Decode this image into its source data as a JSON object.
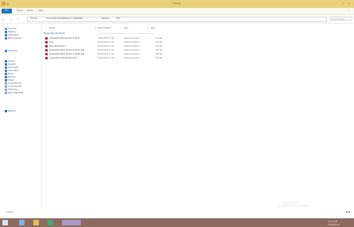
{
  "window": {
    "title": "Pictures",
    "controls": [
      "–",
      "□",
      "×"
    ]
  },
  "ribbon": {
    "file_tab": "File",
    "tabs": [
      "Home",
      "Share",
      "View"
    ],
    "help": "?"
  },
  "address": {
    "back": "←",
    "forward": "→",
    "up": "↑",
    "path": [
      "This PC",
      "Documents and Settings (C:) DataFiles",
      "Desktop",
      "Pict"
    ],
    "search_placeholder": "Search Pictures"
  },
  "navigation": {
    "favorites": [
      "Favorites",
      "Desktop",
      "Downloads",
      "Recent places"
    ],
    "cloud": [
      "OneDrive"
    ],
    "this_pc": [
      "This PC",
      "Desktop",
      "Documents",
      "Downloads",
      "Music",
      "Pictures",
      "Videos",
      "Local Disk (C:)",
      "Local Disk (D:)",
      "DVD Drive",
      "Removable Disk"
    ],
    "network": [
      "Network"
    ]
  },
  "columns": {
    "name": "Name",
    "date": "Date modified",
    "type": "Type",
    "size": "Size"
  },
  "group": {
    "label": "Earlier this month (6)"
  },
  "files": [
    {
      "name": "Screenshot_2014-10-22-11-35-41",
      "date": "10/22/2014 11:36",
      "type": "Adobe Acrobat D...",
      "size": "312 KB"
    },
    {
      "name": "Scan",
      "date": "10/22/2014 11:35",
      "type": "Adobe Acrobat D...",
      "size": "215 KB"
    },
    {
      "name": "Scan 2014-10-22",
      "date": "10/22/2014 11:34",
      "type": "Adobe Acrobat D...",
      "size": "187 KB"
    },
    {
      "name": "Screenshot_2014-10-22-11-33-27_edit",
      "date": "10/22/2014 11:33",
      "type": "Adobe Acrobat D...",
      "size": "402 KB"
    },
    {
      "name": "Screenshot_2014-10-22-11-32-08_edit",
      "date": "10/22/2014 11:32",
      "type": "Adobe Acrobat D...",
      "size": "398 KB"
    },
    {
      "name": "Screenshot_2014-10-22-11-30",
      "date": "10/22/2014 11:30",
      "type": "Adobe Acrobat D...",
      "size": "276 KB"
    }
  ],
  "status": {
    "items": "6 items"
  },
  "watermark": {
    "line1": "Activate Windows",
    "line2": "Go to Settings to activate Windows."
  },
  "taskbar": {
    "time": "11:37 AM",
    "date": "10/22/2014"
  }
}
